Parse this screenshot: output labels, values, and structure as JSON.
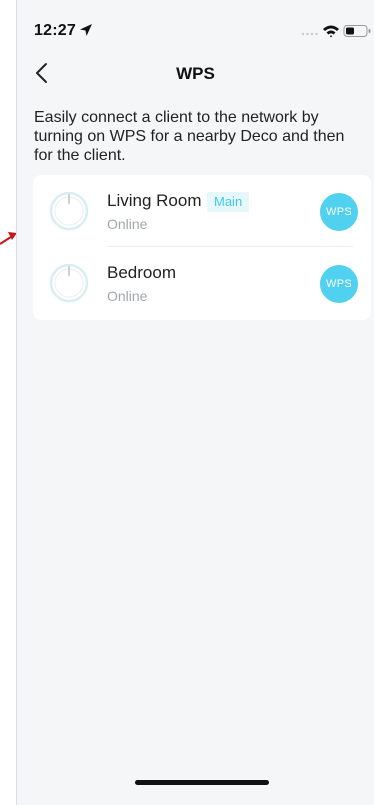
{
  "status_bar": {
    "time": "12:27"
  },
  "nav": {
    "title": "WPS"
  },
  "description": "Easily connect a client to the network by turning on WPS for a nearby Deco and then for the client.",
  "devices": [
    {
      "name": "Living Room",
      "badge": "Main",
      "status": "Online",
      "wps_label": "WPS"
    },
    {
      "name": "Bedroom",
      "status": "Online",
      "wps_label": "WPS"
    }
  ],
  "colors": {
    "accent": "#4fd1ef",
    "badge_bg": "#e6f8fb",
    "badge_text": "#3fc9e0",
    "annotation_red": "#c4161c"
  },
  "icons": {
    "status_location": "location-arrow-icon",
    "status_signal": "cellular-signal-icon",
    "status_wifi": "wifi-icon",
    "status_battery": "battery-icon",
    "back": "chevron-left-icon",
    "deco": "deco-unit-icon"
  }
}
